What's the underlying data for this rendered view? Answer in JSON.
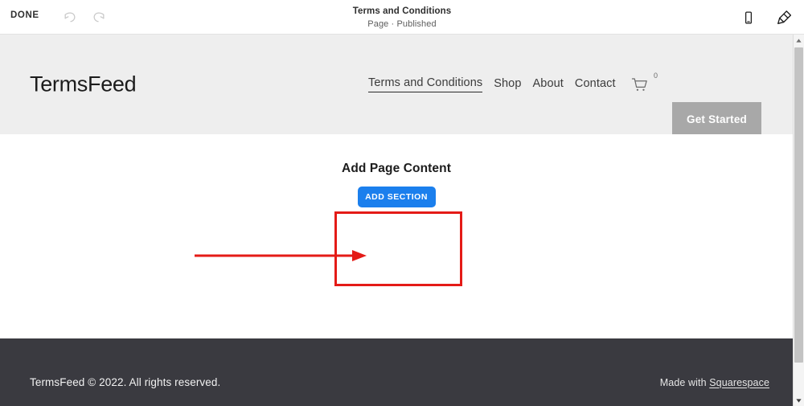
{
  "editor": {
    "done_label": "DONE",
    "undo_icon": "undo-icon",
    "redo_icon": "redo-icon",
    "title": "Terms and Conditions",
    "subtitle": "Page · Published",
    "mobile_preview_icon": "mobile-device-icon",
    "design_icon": "paintbrush-icon"
  },
  "site": {
    "logo": "TermsFeed",
    "nav": [
      {
        "label": "Terms and Conditions",
        "active": true
      },
      {
        "label": "Shop",
        "active": false
      },
      {
        "label": "About",
        "active": false
      },
      {
        "label": "Contact",
        "active": false
      }
    ],
    "cart": {
      "icon": "shopping-cart-icon",
      "count": "0"
    },
    "cta_label": "Get Started",
    "body": {
      "add_content_title": "Add Page Content",
      "add_section_label": "ADD SECTION"
    },
    "footer": {
      "copyright": "TermsFeed © 2022. All rights reserved.",
      "credit_prefix": "Made with ",
      "credit_link": "Squarespace"
    }
  },
  "annotations": {
    "highlight_color": "#e41b17",
    "arrow_color": "#e41b17"
  },
  "theme": {
    "header_bg": "#eeeeee",
    "footer_bg": "#3a3a40",
    "accent_blue": "#1b7fed",
    "cta_gray": "#a8a8a8"
  },
  "scrollbar": {
    "up_arrow": "scroll-up-arrow-icon",
    "down_arrow": "scroll-down-arrow-icon"
  }
}
